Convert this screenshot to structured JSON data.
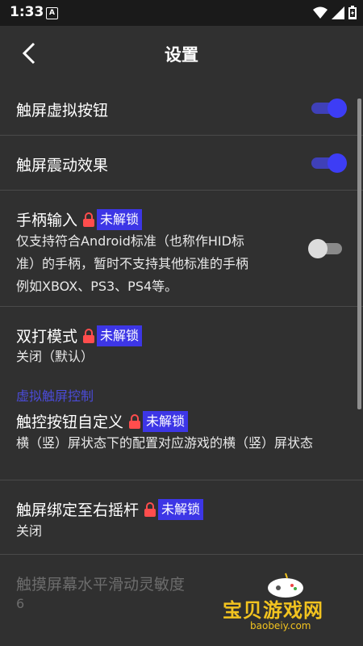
{
  "status_bar": {
    "time": "1:33",
    "notification_icon": "A"
  },
  "header": {
    "title": "设置"
  },
  "rows": [
    {
      "title": "触屏虚拟按钮",
      "toggle": true
    },
    {
      "title": "触屏震动效果",
      "toggle": true
    },
    {
      "title": "手柄输入",
      "badge": "未解锁",
      "desc1": "仅支持符合Android标准（也称作HID标",
      "desc2": "准）的手柄，暂时不支持其他标准的手柄",
      "desc3": "例如XBOX、PS3、PS4等。",
      "toggle": false
    },
    {
      "title": "双打模式",
      "badge": "未解锁",
      "desc1": "关闭（默认）"
    },
    {
      "title": "触控按钮自定义",
      "badge": "未解锁",
      "desc1": "横（竖）屏状态下的配置对应游戏的横（竖）屏状态"
    },
    {
      "title": "触屏绑定至右摇杆",
      "badge": "未解锁",
      "desc1": "关闭"
    },
    {
      "title": "触摸屏幕水平滑动灵敏度",
      "desc1": "6"
    }
  ],
  "section": {
    "label": "虚拟触屏控制"
  },
  "watermark": {
    "text": "宝贝游戏网",
    "url": "baobeiy.com"
  },
  "colors": {
    "accent": "#3d3df5",
    "badge": "#3d36e6",
    "section": "#4b4bd8",
    "background": "#303030"
  }
}
